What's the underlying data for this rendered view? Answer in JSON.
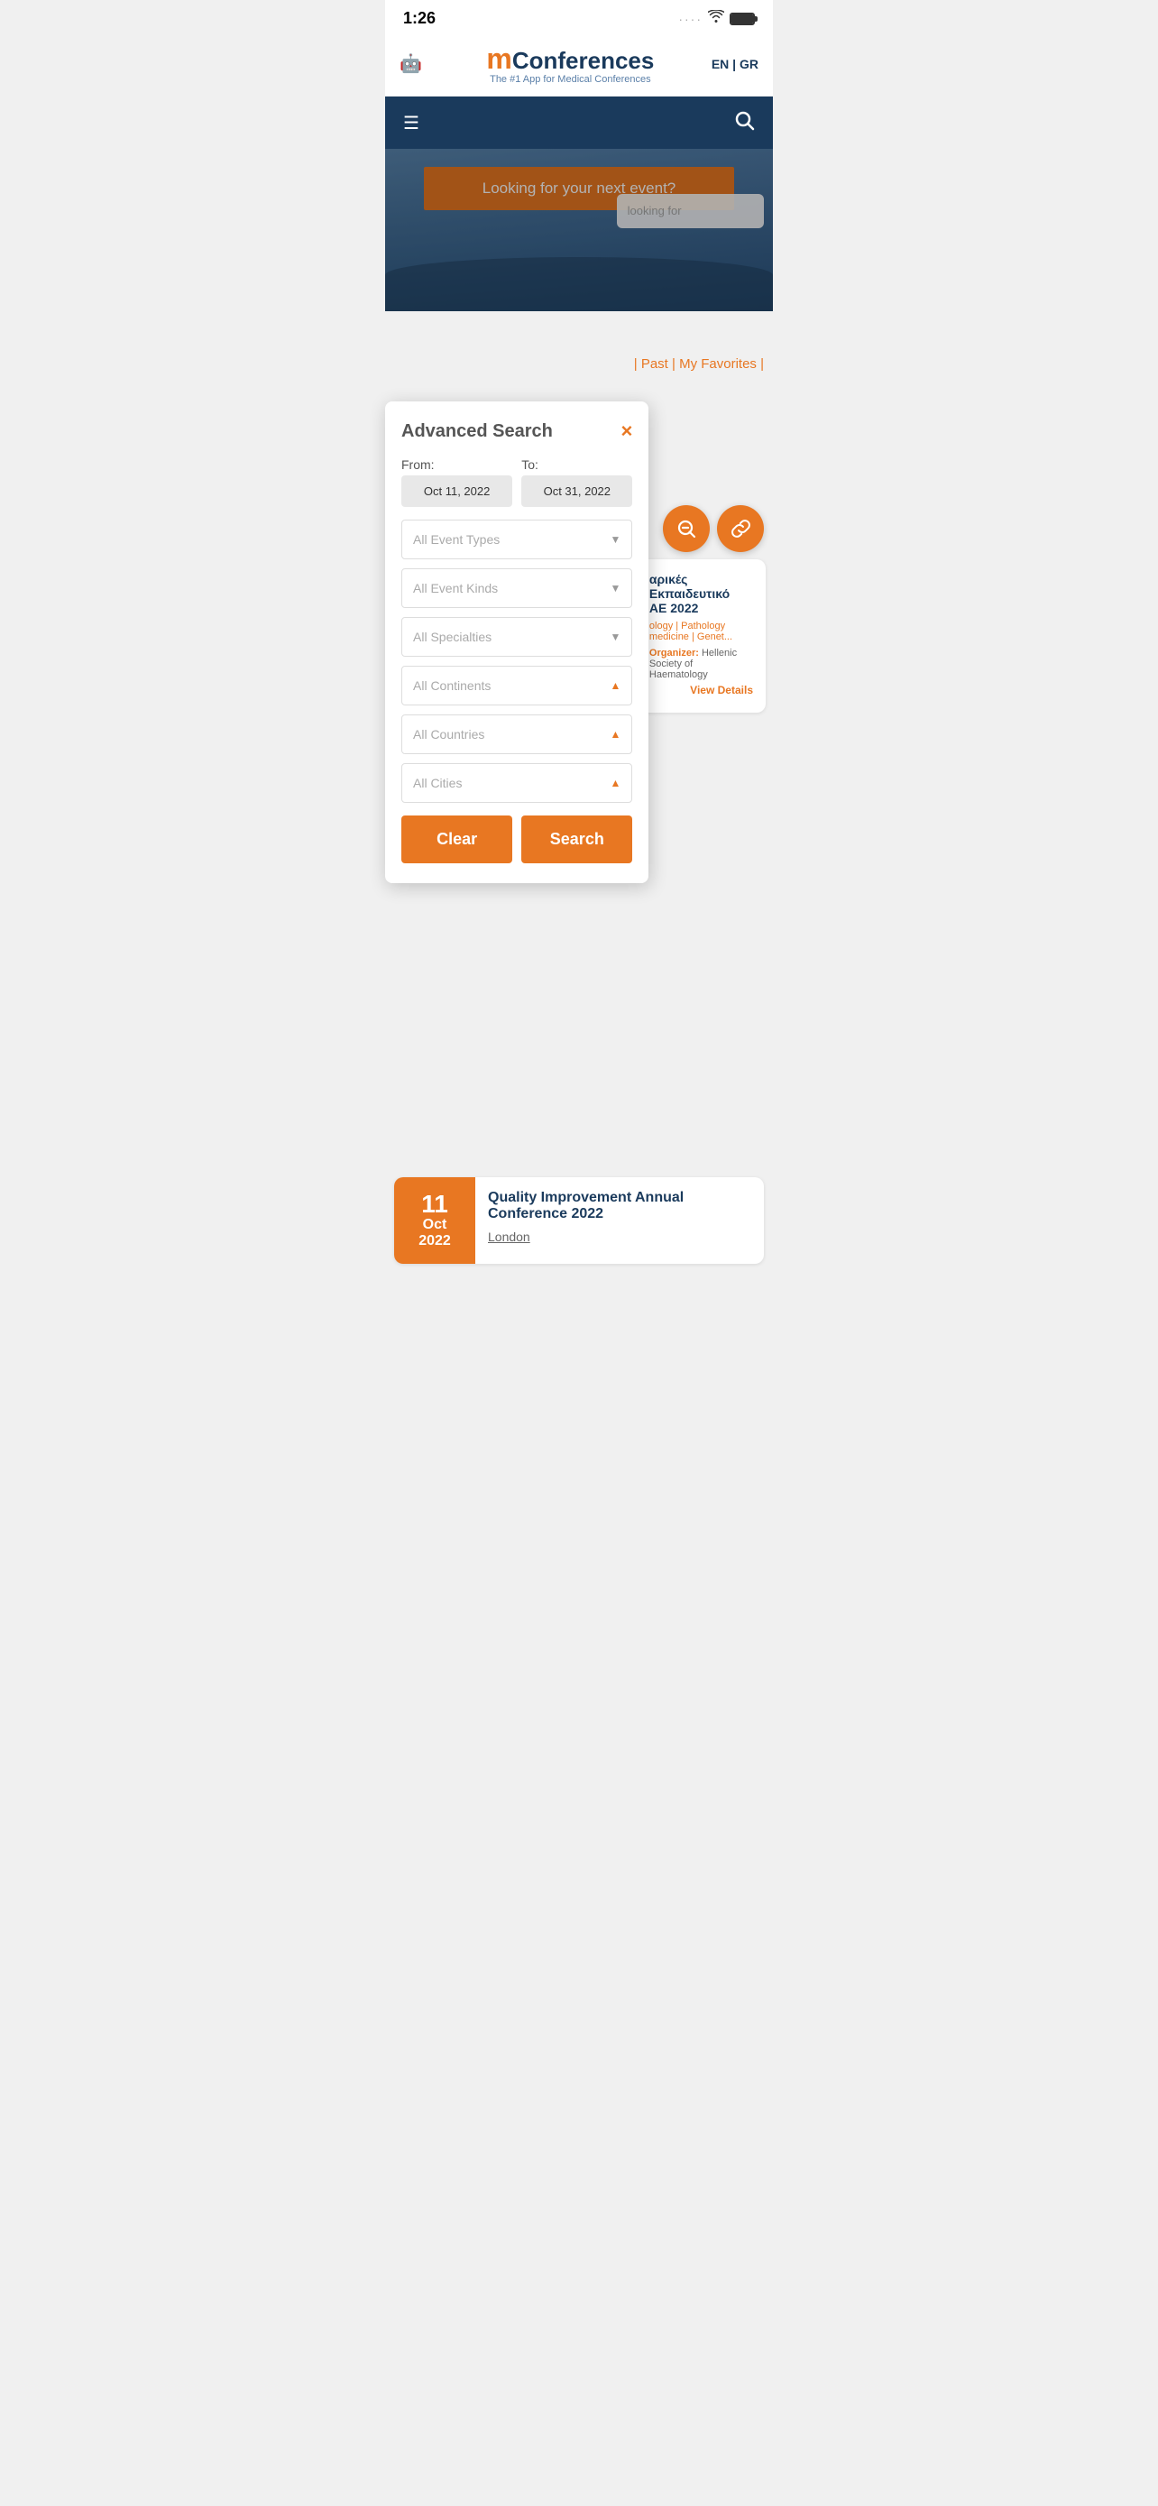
{
  "statusBar": {
    "time": "1:26",
    "dotsLabel": "···· ",
    "wifiLabel": "WiFi",
    "batteryLabel": "Battery"
  },
  "header": {
    "logoM": "m",
    "logoRest": "Conferences",
    "tagline": "The #1 App for Medical Conferences",
    "langEN": "EN",
    "langSeparator": " | ",
    "langGR": "GR",
    "androidIcon": "🤖",
    "appleIcon": ""
  },
  "navbar": {
    "hamburgerIcon": "☰",
    "searchIcon": "🔍"
  },
  "hero": {
    "bannerText": "Looking for your next event?",
    "searchPlaceholder": "looking for"
  },
  "advancedSearch": {
    "title": "Advanced Search",
    "closeLabel": "×",
    "fromLabel": "From:",
    "toLabel": "To:",
    "fromDate": "Oct 11, 2022",
    "toDate": "Oct 31, 2022",
    "dropdowns": [
      {
        "label": "All Event Types",
        "arrowUp": false
      },
      {
        "label": "All Event Kinds",
        "arrowUp": false
      },
      {
        "label": "All Specialties",
        "arrowUp": false
      },
      {
        "label": "All Continents",
        "arrowUp": true
      },
      {
        "label": "All Countries",
        "arrowUp": true
      },
      {
        "label": "All Cities",
        "arrowUp": true
      }
    ],
    "clearButton": "Clear",
    "searchButton": "Search"
  },
  "tabs": {
    "pastLabel": "Past",
    "separator": " | ",
    "myFavoritesLabel": "My Favorites",
    "trailingPipe": " |"
  },
  "actionIcons": {
    "magnifyIcon": "🔍",
    "linkIcon": "🔗"
  },
  "events": [
    {
      "title": "αρικές Εκπαιδευτικό ΑΕ 2022",
      "tags": "ology | Pathology | medicine | Genet...",
      "organizer": "Hellenic Society of Haematology",
      "organizerLabel": "Organizer:",
      "viewDetails": "View Details",
      "dateDay": "",
      "dateMonth": "",
      "dateYear": "",
      "partial": true
    },
    {
      "title": "Quality Improvement Annual Conference 2022",
      "location": "London",
      "dateDay": "11",
      "dateMonth": "Oct",
      "dateYear": "2022",
      "partial": false
    }
  ]
}
